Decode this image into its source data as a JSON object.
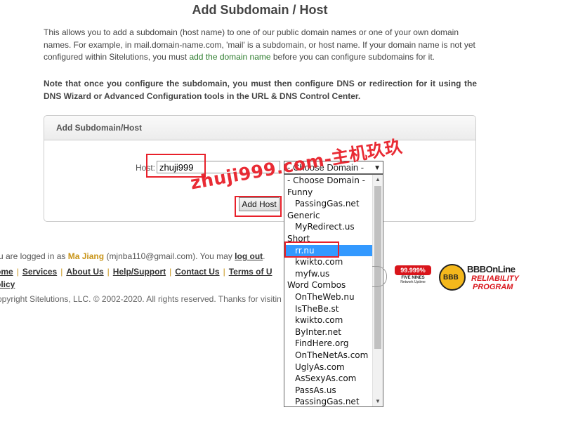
{
  "page": {
    "title": "Add Subdomain / Host",
    "intro_part1": "This allows you to add a subdomain (host name) to one of our public domain names or one of your own domain names. For example, in mail.domain-name.com, 'mail' is a subdomain, or host name. If your domain name is not yet configured within Sitelutions, you must ",
    "intro_link": "add the domain name",
    "intro_part2": " before you can configure subdomains for it.",
    "note": "Note that once you configure the subdomain, you must then configure DNS or redirection for it using the DNS Wizard or Advanced Configuration tools in the URL & DNS Control Center."
  },
  "panel": {
    "header": "Add Subdomain/Host",
    "host_label": "Host:",
    "host_value": "zhuji999",
    "select_value": "- Choose Domain -",
    "add_button": "Add Host"
  },
  "dropdown": {
    "items": [
      {
        "label": "- Choose Domain -",
        "type": "group"
      },
      {
        "label": "Funny",
        "type": "group"
      },
      {
        "label": "PassingGas.net",
        "type": "opt"
      },
      {
        "label": "Generic",
        "type": "group"
      },
      {
        "label": "MyRedirect.us",
        "type": "opt"
      },
      {
        "label": "Short",
        "type": "group"
      },
      {
        "label": "rr.nu",
        "type": "opt",
        "selected": true
      },
      {
        "label": "kwikto.com",
        "type": "opt"
      },
      {
        "label": "myfw.us",
        "type": "opt"
      },
      {
        "label": "Word Combos",
        "type": "group"
      },
      {
        "label": "OnTheWeb.nu",
        "type": "opt"
      },
      {
        "label": "IsTheBe.st",
        "type": "opt"
      },
      {
        "label": "kwikto.com",
        "type": "opt"
      },
      {
        "label": "ByInter.net",
        "type": "opt"
      },
      {
        "label": "FindHere.org",
        "type": "opt"
      },
      {
        "label": "OnTheNetAs.com",
        "type": "opt"
      },
      {
        "label": "UglyAs.com",
        "type": "opt"
      },
      {
        "label": "AsSexyAs.com",
        "type": "opt"
      },
      {
        "label": "PassAs.us",
        "type": "opt"
      },
      {
        "label": "PassingGas.net",
        "type": "opt"
      }
    ]
  },
  "watermark": "zhuji999.com-主机玖玖",
  "footer": {
    "logged_prefix": "u are logged in as ",
    "user_name": "Ma Jiang",
    "user_email": " (mjnba110@gmail.com). You may ",
    "logout": "log out",
    "logout_suffix": ".",
    "links": [
      "ome",
      "Services",
      "About Us",
      "Help/Support",
      "Contact Us",
      "Terms of U"
    ],
    "policy": "olicy",
    "copyright": "opyright Sitelutions, LLC. © 2002-2020. All rights reserved.  Thanks for visitin"
  },
  "badges": {
    "uptime_percent": "99.999%",
    "uptime_label": "FIVE NINES",
    "uptime_sub": "Network Uptime",
    "bbb_seal": "BBB",
    "bbb_title": "BBBOnLine",
    "bbb_line2": "RELIABILITY",
    "bbb_line3": "PROGRAM"
  },
  "colors": {
    "accent_red": "#e8202a",
    "selected_blue": "#3399ff",
    "user_gold": "#c89417",
    "link_green": "#2a7a2a"
  }
}
